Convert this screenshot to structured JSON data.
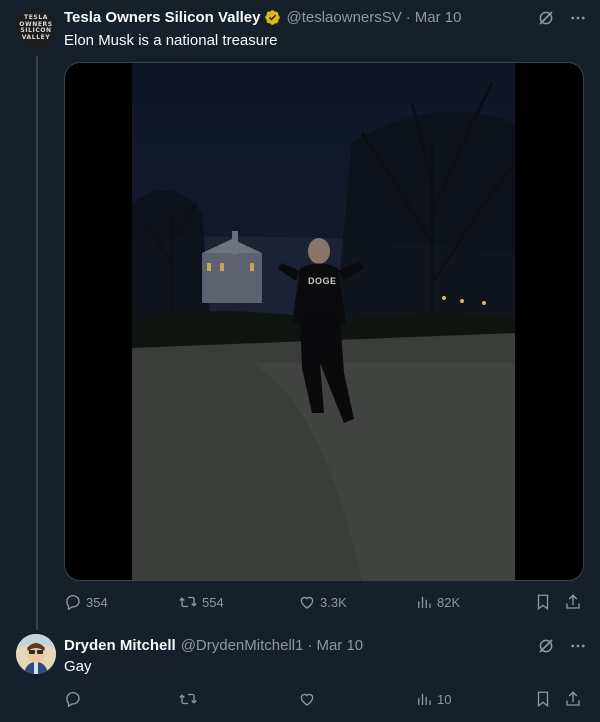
{
  "tweet1": {
    "avatar_text": [
      "TESLA",
      "OWNERS",
      "SILICON",
      "VALLEY"
    ],
    "name": "Tesla Owners Silicon Valley",
    "handle": "@teslaownersSV",
    "separator": "·",
    "date": "Mar 10",
    "text": "Elon Musk is a national treasure",
    "video_shirt_text": "DOGE",
    "replies": "354",
    "reposts": "554",
    "likes": "3.3K",
    "views": "82K"
  },
  "tweet2": {
    "name": "Dryden Mitchell",
    "handle": "@DrydenMitchell1",
    "separator": "·",
    "date": "Mar 10",
    "text": "Gay",
    "replies": "",
    "reposts": "",
    "likes": "",
    "views": "10"
  },
  "colors": {
    "background": "#15202b",
    "muted": "#8b98a5",
    "verified_badge": "#e2b719",
    "border": "#38444d"
  },
  "icons": [
    "grok-icon",
    "more-icon",
    "verified-icon",
    "reply-icon",
    "repost-icon",
    "like-icon",
    "views-icon",
    "bookmark-icon",
    "share-icon"
  ]
}
